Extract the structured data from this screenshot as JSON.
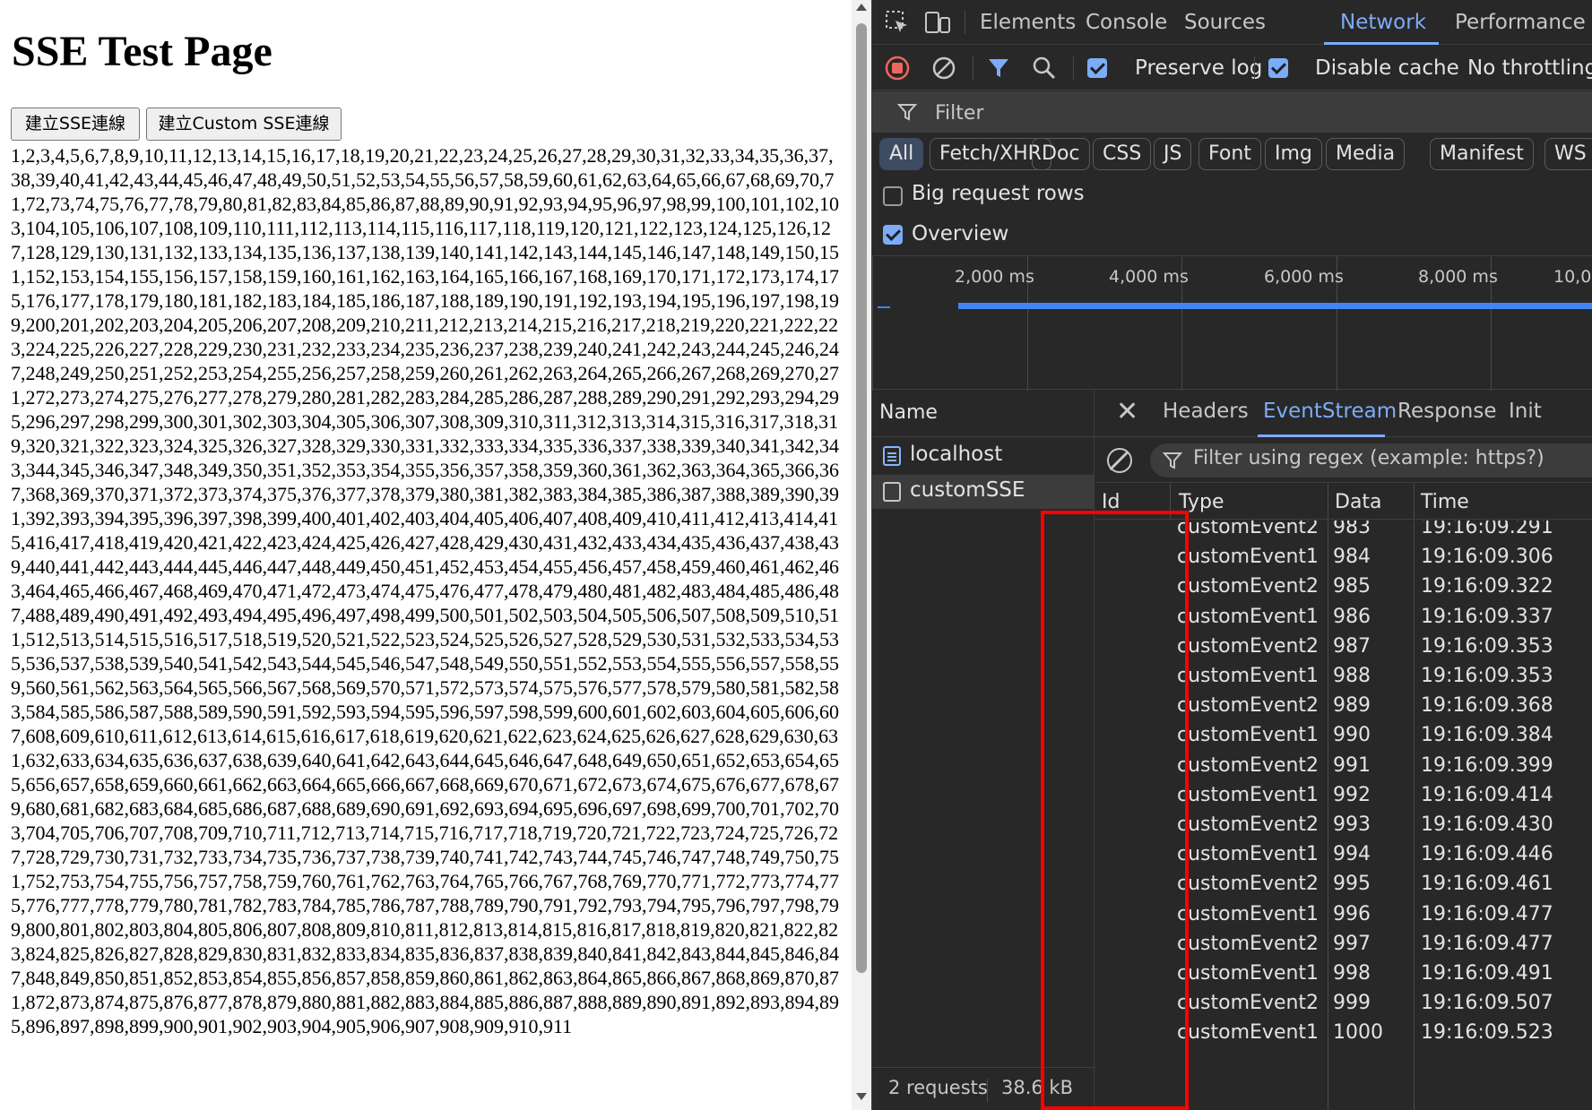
{
  "page": {
    "title": "SSE Test Page",
    "btn_sse": "建立SSE連線",
    "btn_custom": "建立Custom SSE連線",
    "numbers_start": 1,
    "numbers_end": 911
  },
  "devtools": {
    "tabs": [
      "Elements",
      "Console",
      "Sources",
      "Network",
      "Performance"
    ],
    "active_tab": "Network",
    "toolbar": {
      "preserve_log": "Preserve log",
      "disable_cache": "Disable cache",
      "throttling": "No throttling"
    },
    "filter_placeholder": "Filter",
    "type_filters": [
      "All",
      "Fetch/XHR",
      "Doc",
      "CSS",
      "JS",
      "Font",
      "Img",
      "Media",
      "Manifest",
      "WS"
    ],
    "big_request_rows": "Big request rows",
    "overview_label": "Overview",
    "overview_ticks": [
      "2,000 ms",
      "4,000 ms",
      "6,000 ms",
      "8,000 ms",
      "10,0"
    ],
    "name_header": "Name",
    "requests": [
      {
        "name": "localhost",
        "icon": "document-icon"
      },
      {
        "name": "customSSE",
        "icon": "checkbox-icon"
      }
    ],
    "status": {
      "requests": "2 requests",
      "size": "38.6 kB"
    },
    "detail_tabs": [
      "Headers",
      "EventStream",
      "Response",
      "Init"
    ],
    "active_detail_tab": "EventStream",
    "es_filter_placeholder": "Filter using regex (example: https?)",
    "es_columns": {
      "id": "Id",
      "type": "Type",
      "data": "Data",
      "time": "Time"
    },
    "events": [
      {
        "type": "customEvent2",
        "data": "983",
        "time": "19:16:09.291"
      },
      {
        "type": "customEvent1",
        "data": "984",
        "time": "19:16:09.306"
      },
      {
        "type": "customEvent2",
        "data": "985",
        "time": "19:16:09.322"
      },
      {
        "type": "customEvent1",
        "data": "986",
        "time": "19:16:09.337"
      },
      {
        "type": "customEvent2",
        "data": "987",
        "time": "19:16:09.353"
      },
      {
        "type": "customEvent1",
        "data": "988",
        "time": "19:16:09.353"
      },
      {
        "type": "customEvent2",
        "data": "989",
        "time": "19:16:09.368"
      },
      {
        "type": "customEvent1",
        "data": "990",
        "time": "19:16:09.384"
      },
      {
        "type": "customEvent2",
        "data": "991",
        "time": "19:16:09.399"
      },
      {
        "type": "customEvent1",
        "data": "992",
        "time": "19:16:09.414"
      },
      {
        "type": "customEvent2",
        "data": "993",
        "time": "19:16:09.430"
      },
      {
        "type": "customEvent1",
        "data": "994",
        "time": "19:16:09.446"
      },
      {
        "type": "customEvent2",
        "data": "995",
        "time": "19:16:09.461"
      },
      {
        "type": "customEvent1",
        "data": "996",
        "time": "19:16:09.477"
      },
      {
        "type": "customEvent2",
        "data": "997",
        "time": "19:16:09.477"
      },
      {
        "type": "customEvent1",
        "data": "998",
        "time": "19:16:09.491"
      },
      {
        "type": "customEvent2",
        "data": "999",
        "time": "19:16:09.507"
      },
      {
        "type": "customEvent1",
        "data": "1000",
        "time": "19:16:09.523"
      }
    ],
    "colors": {
      "accent": "#7cacf8",
      "highlight": "#ff0000",
      "bg": "#282828"
    }
  }
}
